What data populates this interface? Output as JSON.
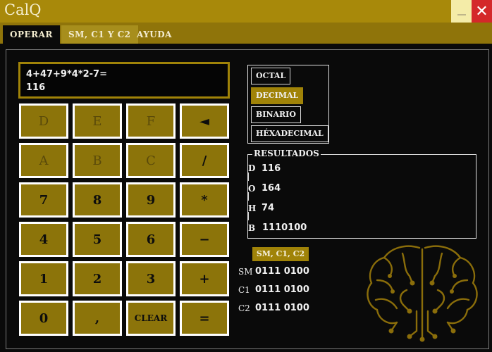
{
  "window": {
    "title": "CalQ"
  },
  "menu": {
    "items": [
      "OPERAR",
      "SM, C1 Y C2",
      "AYUDA"
    ]
  },
  "display": {
    "expression": "4+47+9*4*2-7=",
    "result": "116"
  },
  "keypad": {
    "keys": [
      "D",
      "E",
      "F",
      "◄",
      "A",
      "B",
      "C",
      "/",
      "7",
      "8",
      "9",
      "*",
      "4",
      "5",
      "6",
      "−",
      "1",
      "2",
      "3",
      "+",
      "0",
      ",",
      "CLEAR",
      "="
    ]
  },
  "base_selector": {
    "options": [
      "OCTAL",
      "DECIMAL",
      "BINARIO",
      "HÉXADECIMAL"
    ],
    "selected": "DECIMAL"
  },
  "results": {
    "legend": "RESULTADOS",
    "rows": [
      {
        "label": "D",
        "value": "116"
      },
      {
        "label": "O",
        "value": "164"
      },
      {
        "label": "H",
        "value": "74"
      },
      {
        "label": "B",
        "value": "1110100"
      }
    ]
  },
  "complements": {
    "button": "SM, C1, C2",
    "rows": [
      {
        "label": "SM",
        "value": "0111 0100"
      },
      {
        "label": "C1",
        "value": "0111 0100"
      },
      {
        "label": "C2",
        "value": "0111 0100"
      }
    ]
  },
  "colors": {
    "gold": "#a08308",
    "key_fill": "#8c740a",
    "close_red": "#d4282a",
    "background": "#0a0a0a"
  },
  "icons": {
    "minimize": "minimize-icon",
    "close": "close-icon",
    "backspace": "backspace-icon",
    "logo": "brain-circuit-icon"
  }
}
